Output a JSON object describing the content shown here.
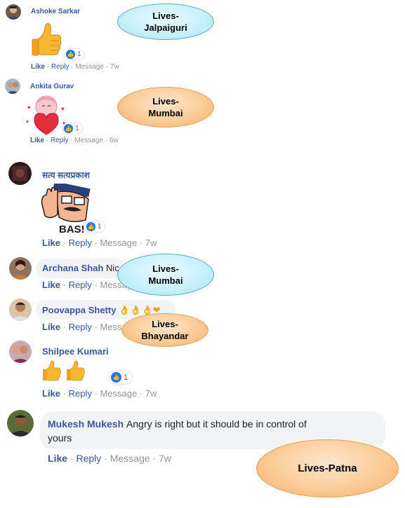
{
  "comments": [
    {
      "name": "Ashoke Sarkar",
      "text": "",
      "reactions": "1",
      "like": "Like",
      "reply": "Reply",
      "message": "Message",
      "time": "7w"
    },
    {
      "name": "Ankita Gurav",
      "text": "",
      "reactions": "1",
      "like": "Like",
      "reply": "Reply",
      "message": "Message",
      "time": "6w"
    },
    {
      "name": "सत्य सत्यप्रकाश",
      "text": "",
      "reactions": "1",
      "like": "Like",
      "reply": "Reply",
      "message": "Message",
      "time": "7w",
      "sticker_text": "BAS!"
    },
    {
      "name": "Archana Shah",
      "text": "Nic",
      "like": "Like",
      "reply": "Reply",
      "message": "Messag"
    },
    {
      "name": "Poovappa Shetty",
      "text": "👌👌👌❤",
      "like": "Like",
      "reply": "Reply",
      "message": "Messag"
    },
    {
      "name": "Shilpee Kumari",
      "text": "",
      "reactions": "1",
      "like": "Like",
      "reply": "Reply",
      "message": "Message",
      "time": "7w"
    },
    {
      "name": "Mukesh Mukesh",
      "text": "Angry is right but it should be in control of",
      "text2": "yours",
      "like": "Like",
      "reply": "Reply",
      "message": "Message",
      "time": "7w"
    }
  ],
  "callouts": [
    {
      "line1": "Lives-",
      "line2": "Jalpaiguri"
    },
    {
      "line1": "Lives-",
      "line2": "Mumbai"
    },
    {
      "line1": "Lives-",
      "line2": "Mumbai"
    },
    {
      "line1": "Lives-",
      "line2": "Bhayandar"
    },
    {
      "line1": "Lives-Patna",
      "line2": ""
    }
  ],
  "colors": {
    "link": "#385898",
    "meta": "#90949c",
    "bubble": "#f2f3f5",
    "callout_blue": "#c9f1fb",
    "callout_orange": "#fbcc98"
  },
  "separator": "·"
}
